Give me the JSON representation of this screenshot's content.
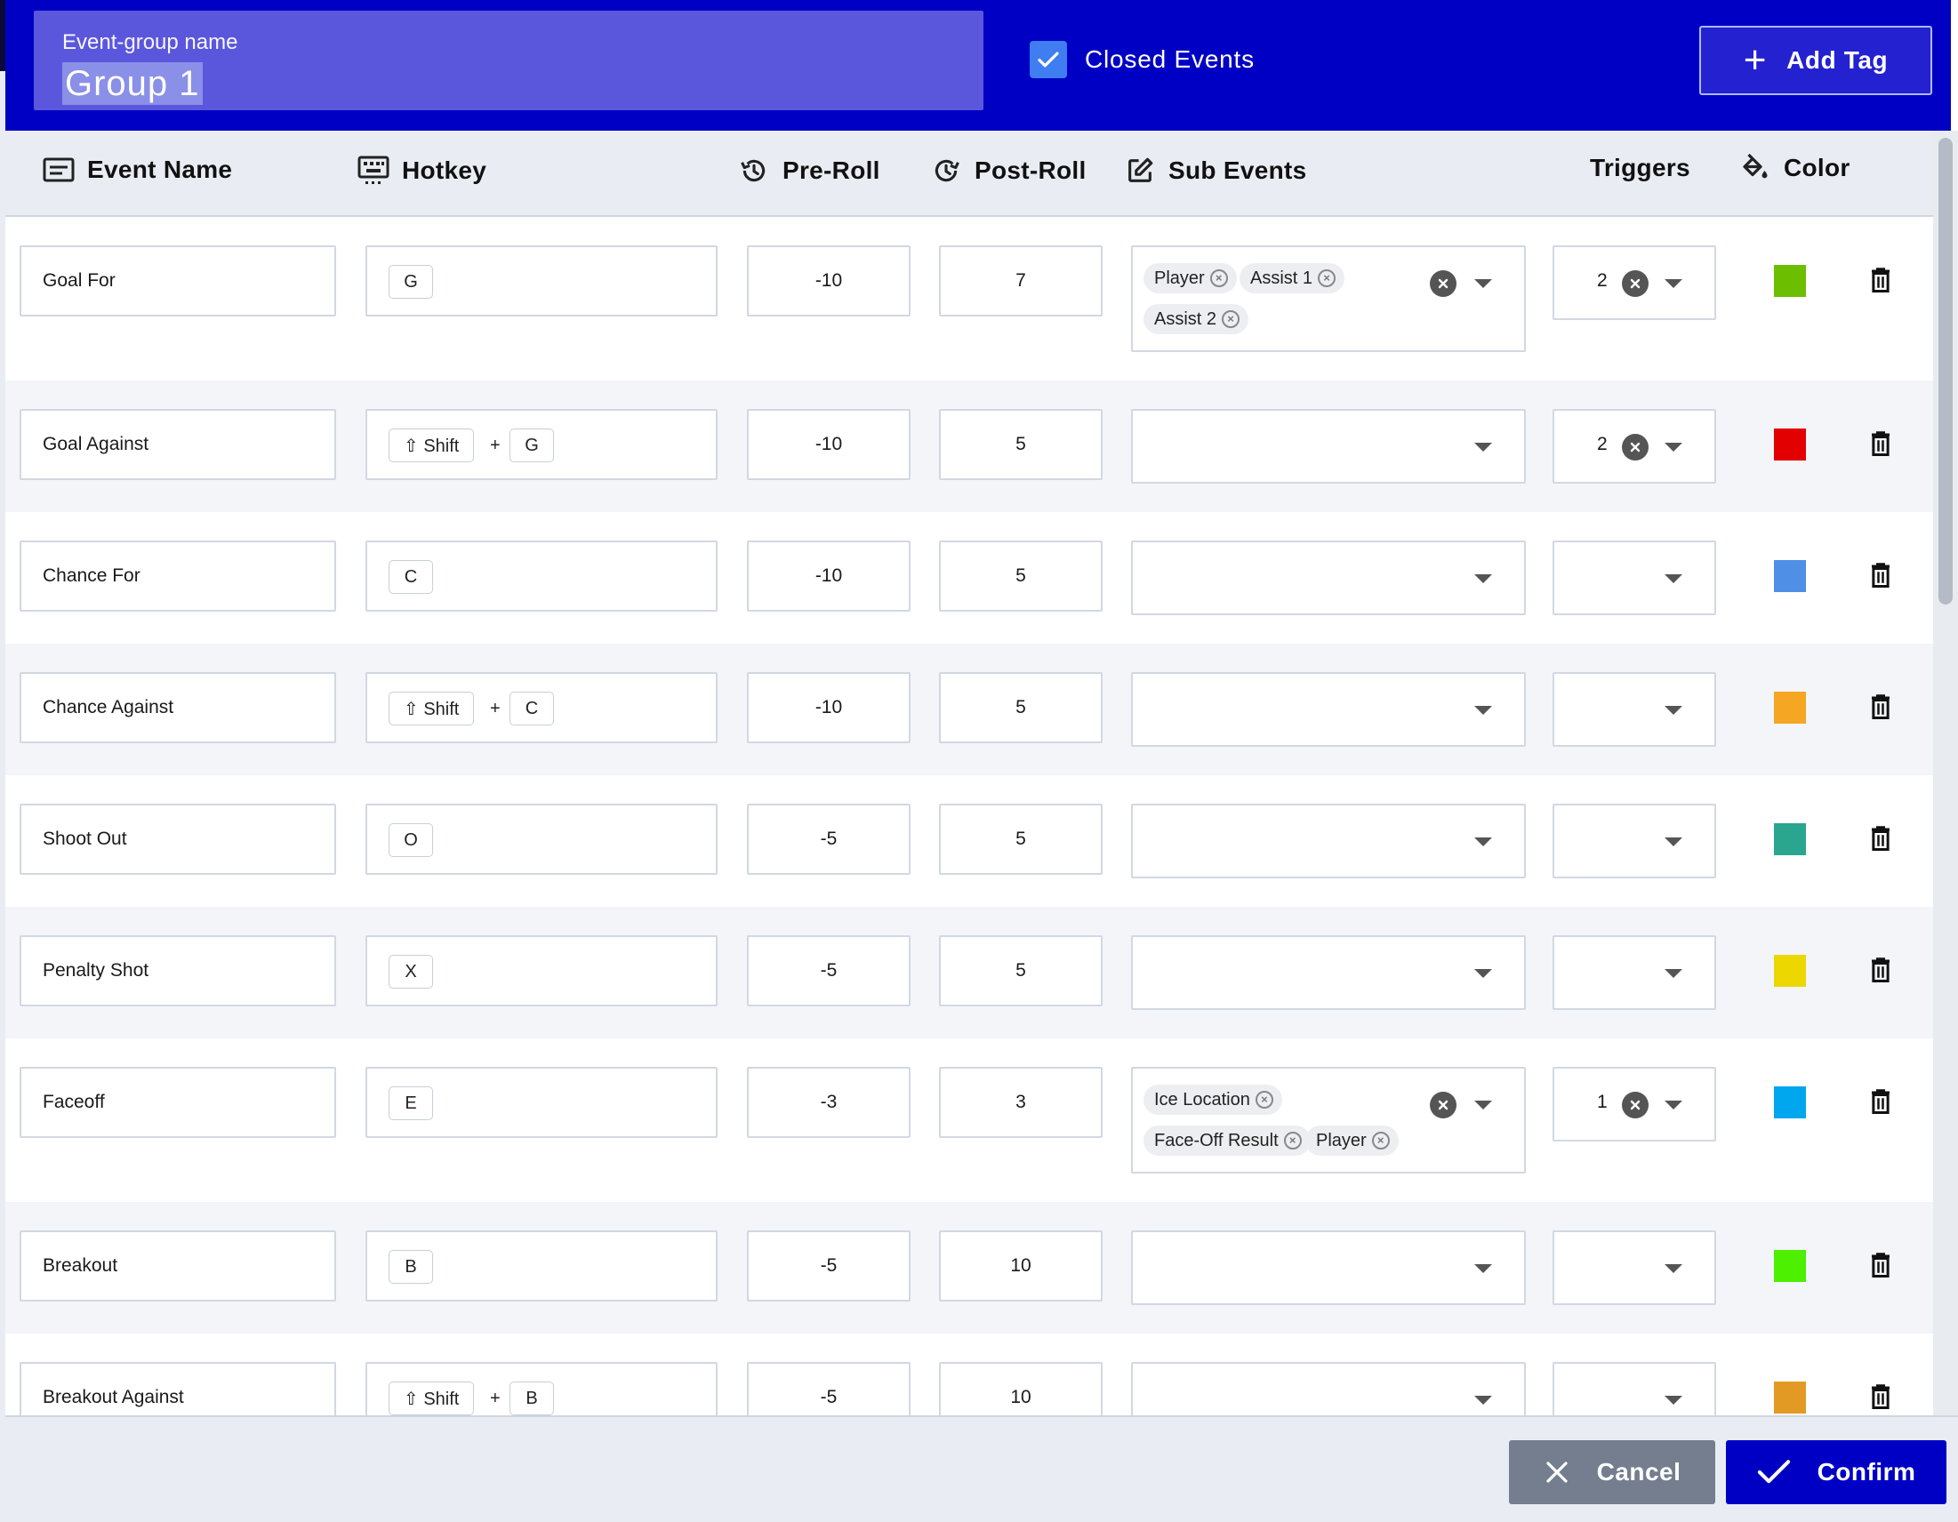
{
  "header": {
    "group_name_label": "Event-group name",
    "group_name_value": "Group 1",
    "closed_events_label": "Closed Events",
    "closed_events_checked": true,
    "add_tag_label": "Add Tag"
  },
  "columns": {
    "event_name": "Event Name",
    "hotkey": "Hotkey",
    "pre_roll": "Pre-Roll",
    "post_roll": "Post-Roll",
    "sub_events": "Sub Events",
    "triggers": "Triggers",
    "color": "Color"
  },
  "rows": [
    {
      "name": "Goal For",
      "keys": [
        "G"
      ],
      "pre": "-10",
      "post": "7",
      "sub_events": [
        "Player",
        "Assist 1",
        "Assist 2"
      ],
      "triggers": "2",
      "color": "#6cbf00"
    },
    {
      "name": "Goal Against",
      "keys": [
        "⇧ Shift",
        "G"
      ],
      "pre": "-10",
      "post": "5",
      "sub_events": [],
      "triggers": "2",
      "color": "#e30000"
    },
    {
      "name": "Chance For",
      "keys": [
        "C"
      ],
      "pre": "-10",
      "post": "5",
      "sub_events": [],
      "triggers": "",
      "color": "#4f8fe6"
    },
    {
      "name": "Chance Against",
      "keys": [
        "⇧ Shift",
        "C"
      ],
      "pre": "-10",
      "post": "5",
      "sub_events": [],
      "triggers": "",
      "color": "#f5a623"
    },
    {
      "name": "Shoot Out",
      "keys": [
        "O"
      ],
      "pre": "-5",
      "post": "5",
      "sub_events": [],
      "triggers": "",
      "color": "#2aa58e"
    },
    {
      "name": "Penalty Shot",
      "keys": [
        "X"
      ],
      "pre": "-5",
      "post": "5",
      "sub_events": [],
      "triggers": "",
      "color": "#ecd800"
    },
    {
      "name": "Faceoff",
      "keys": [
        "E"
      ],
      "pre": "-3",
      "post": "3",
      "sub_events": [
        "Ice Location",
        "Face-Off Result",
        "Player"
      ],
      "triggers": "1",
      "color": "#00a6ee"
    },
    {
      "name": "Breakout",
      "keys": [
        "B"
      ],
      "pre": "-5",
      "post": "10",
      "sub_events": [],
      "triggers": "",
      "color": "#4cf000"
    },
    {
      "name": "Breakout Against",
      "keys": [
        "⇧ Shift",
        "B"
      ],
      "pre": "-5",
      "post": "10",
      "sub_events": [],
      "triggers": "",
      "color": "#e39a24"
    }
  ],
  "hotkey_join": "+",
  "footer": {
    "cancel_label": "Cancel",
    "confirm_label": "Confirm"
  },
  "icons": {
    "event_name": "list-alt-icon",
    "hotkey": "keyboard-icon",
    "pre_roll": "history-icon",
    "post_roll": "redo-clock-icon",
    "sub_events": "edit-square-icon",
    "color": "paint-bucket-icon",
    "delete": "trash-icon",
    "cancel": "close-icon",
    "confirm": "check-icon"
  }
}
